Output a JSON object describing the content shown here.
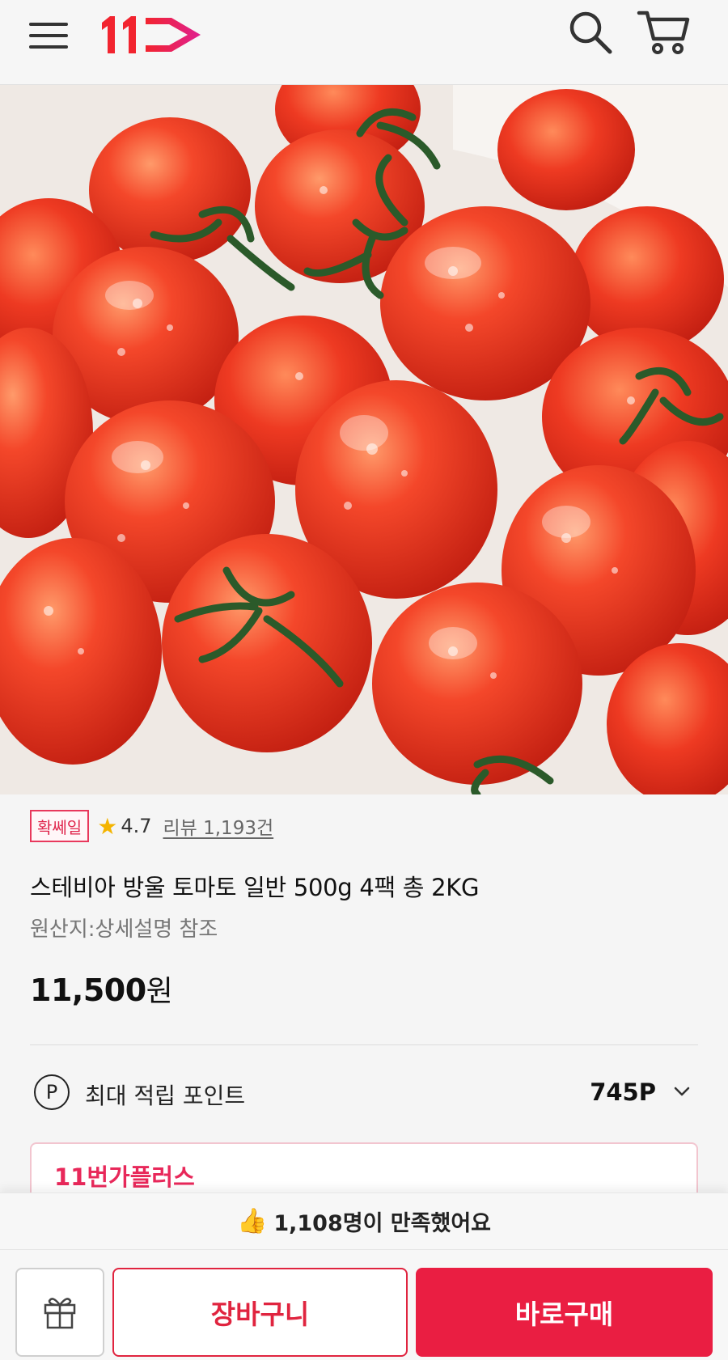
{
  "header": {
    "logo_text": "11",
    "brand_color": "#e8184a"
  },
  "product": {
    "image_description_icon": "cherry-tomato-photo",
    "badge": "확쎄일",
    "rating": "4.7",
    "review_link": "리뷰 1,193건",
    "title": "스테비아 방울 토마토 일반 500g 4팩 총 2KG",
    "origin": "원산지:상세설명 참조",
    "price_number": "11,500",
    "price_unit": "원"
  },
  "points": {
    "icon_letter": "P",
    "label": "최대 적립 포인트",
    "value": "745P"
  },
  "plus_card": {
    "title": "11번가플러스"
  },
  "satisfaction": {
    "icon": "👍",
    "text": "1,108명이 만족했어요"
  },
  "bottom_bar": {
    "cart_label": "장바구니",
    "buy_label": "바로구매"
  },
  "colors": {
    "accent": "#ea1e42",
    "badge_border": "#e8385c",
    "star": "#f4b400"
  }
}
